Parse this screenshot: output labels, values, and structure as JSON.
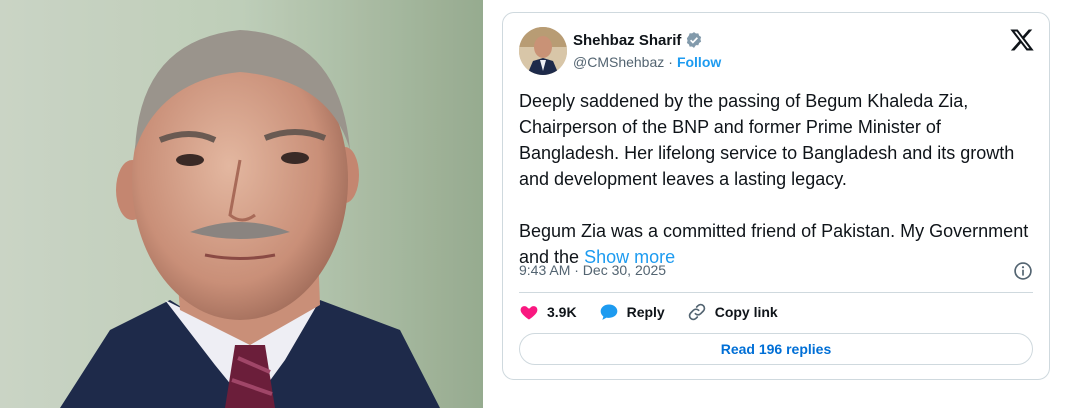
{
  "tweet": {
    "author_name": "Shehbaz Sharif",
    "handle": "@CMShehbaz",
    "separator": "·",
    "follow_label": "Follow",
    "body_paragraph_1": "Deeply saddened by the passing of Begum Khaleda Zia, Chairperson of the BNP and former Prime Minister of Bangladesh. Her lifelong service to Bangladesh and its growth and development leaves a lasting legacy.",
    "body_paragraph_2": "Begum Zia was a committed friend of Pakistan. My Government and the",
    "show_more_label": "Show more",
    "timestamp": "9:43 AM · Dec 30, 2025",
    "likes_count": "3.9K",
    "reply_label": "Reply",
    "copy_link_label": "Copy link",
    "read_replies_label": "Read 196 replies"
  },
  "colors": {
    "accent": "#1d9bf0",
    "like_pink": "#f91880",
    "muted": "#536471",
    "text": "#0f1419"
  },
  "icons": [
    "verified-badge-icon",
    "x-logo-icon",
    "info-icon",
    "heart-icon",
    "reply-icon",
    "link-icon"
  ]
}
